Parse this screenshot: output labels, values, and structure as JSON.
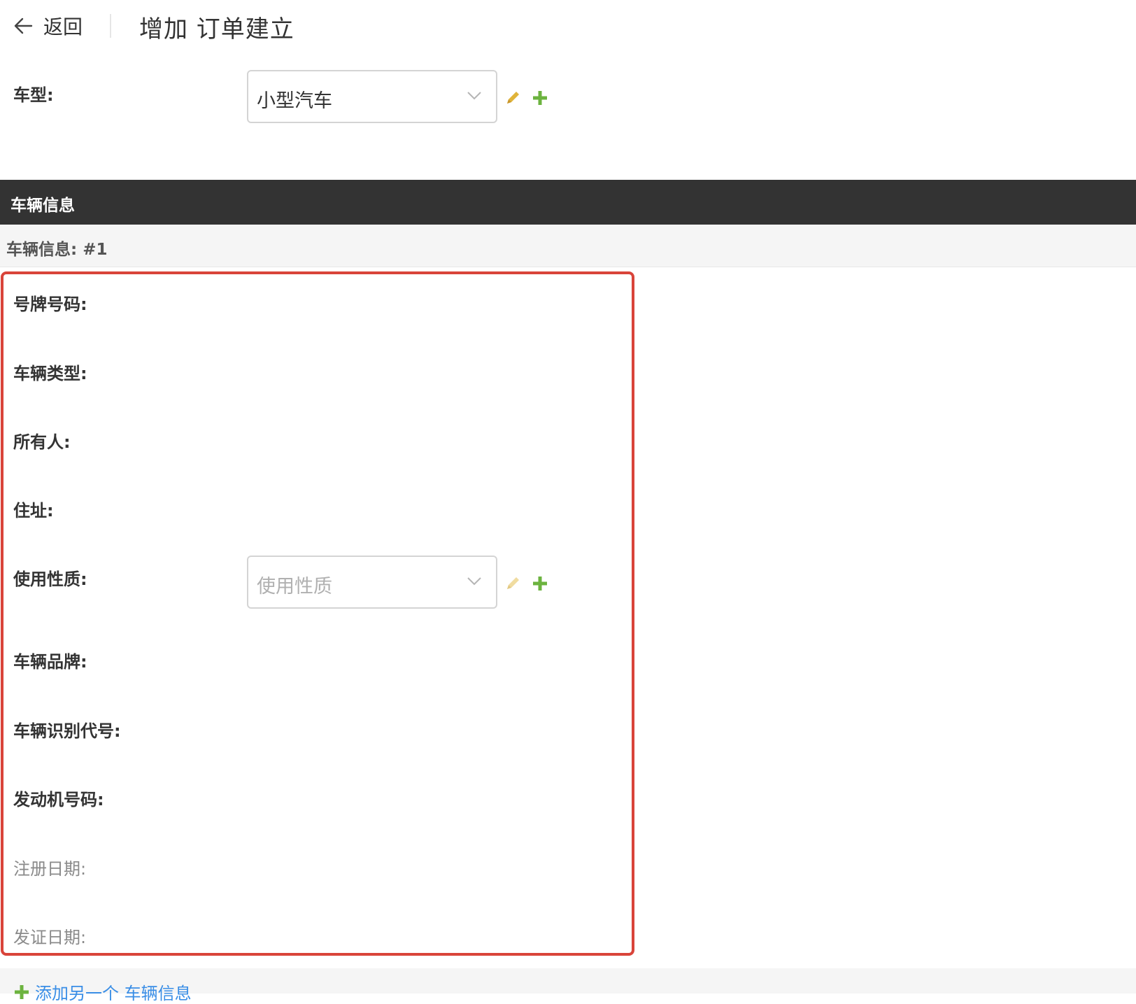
{
  "header": {
    "back_label": "返回",
    "title": "增加 订单建立"
  },
  "car_type": {
    "label": "车型:",
    "selected": "小型汽车"
  },
  "section": {
    "title": "车辆信息",
    "subtitle": "车辆信息: #1"
  },
  "vehicle_fields": {
    "plate_number": "号牌号码:",
    "vehicle_type": "车辆类型:",
    "owner": "所有人:",
    "address": "住址:",
    "usage_nature": "使用性质:",
    "usage_placeholder": "使用性质",
    "brand": "车辆品牌:",
    "vin": "车辆识别代号:",
    "engine_number": "发动机号码:",
    "register_date": "注册日期:",
    "issue_date": "发证日期:"
  },
  "add_another": "添加另一个 车辆信息",
  "colors": {
    "section_bar": "#333333",
    "highlight_border": "#d9443a",
    "add_icon_green": "#6cb33f",
    "edit_icon_yellow": "#e0b43a",
    "link_blue": "#3a8ee6"
  },
  "icons": [
    "back-arrow-icon",
    "chevron-down-icon",
    "pencil-icon",
    "plus-icon"
  ]
}
